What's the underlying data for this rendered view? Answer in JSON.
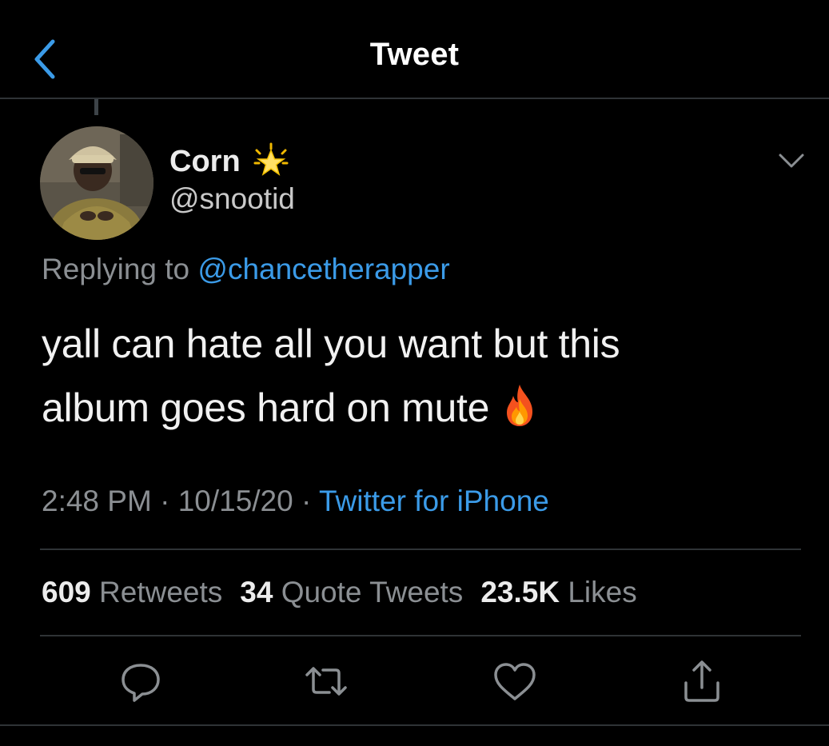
{
  "header": {
    "title": "Tweet",
    "back_icon": "chevron-left-icon"
  },
  "tweet": {
    "author": {
      "display_name": "Corn",
      "name_emoji": "glowing-star-icon",
      "handle": "@snootid"
    },
    "replying_prefix": "Replying to",
    "replying_to": "@chancetherapper",
    "text_line1": "yall can hate all you want but this",
    "text_line2": "album goes hard on mute",
    "text_emoji": "fire-icon",
    "time": "2:48 PM",
    "date": "10/15/20",
    "source": "Twitter for iPhone",
    "dot": "·"
  },
  "stats": {
    "retweets_count": "609",
    "retweets_label": "Retweets",
    "quotes_count": "34",
    "quotes_label": "Quote Tweets",
    "likes_count": "23.5K",
    "likes_label": "Likes"
  },
  "actions": [
    "reply-icon",
    "retweet-icon",
    "like-icon",
    "share-icon"
  ],
  "colors": {
    "background": "#000000",
    "accent": "#3b9be8",
    "divider": "#2f3336",
    "muted": "#8b8f93",
    "icon": "#8b8f93"
  }
}
